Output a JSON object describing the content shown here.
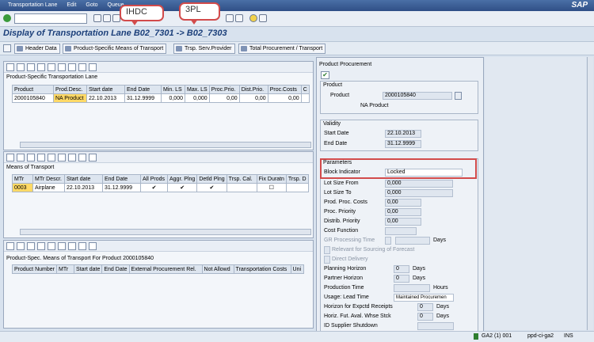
{
  "menu": [
    "Transportation Lane",
    "Edit",
    "Goto",
    "Queue",
    "",
    "",
    "tem"
  ],
  "sap_logo": "SAP",
  "title": "Display of Transportation Lane B02_7301 -> B02_7303",
  "callouts": {
    "a": "IHDC",
    "b": "3PL"
  },
  "app_buttons": [
    "Header Data",
    "Product-Specific Means of Transport",
    "Trsp. Serv.Provider",
    "Total Procurement / Transport"
  ],
  "pane1": {
    "title": "Product-Specific Transportation Lane",
    "headers": [
      "Product",
      "Prod.Desc.",
      "Start date",
      "End Date",
      "Min. LS",
      "Max. LS",
      "Proc.Prio.",
      "Dist.Prio.",
      "Proc.Costs",
      "C"
    ],
    "row": [
      "2000105840",
      "NA Product",
      "22.10.2013",
      "31.12.9999",
      "0,000",
      "0,000",
      "0,00",
      "0,00",
      "0,00",
      ""
    ]
  },
  "pane2": {
    "title": "Means of Transport",
    "headers": [
      "MTr",
      "MTr Descr.",
      "Start date",
      "End Date",
      "All Prods",
      "Aggr. Plng",
      "Detld Plng",
      "Trsp. Cal.",
      "Fix Duratn",
      "Trsp. D"
    ],
    "row": [
      "0003",
      "Airplane",
      "22.10.2013",
      "31.12.9999"
    ]
  },
  "pane3": {
    "title": "Product-Spec. Means of Transport For Product 2000105840",
    "headers": [
      "Product Number",
      "MTr",
      "Start date",
      "End Date",
      "External Procurement Rel.",
      "Not Allowd",
      "Transportation Costs",
      "Uni"
    ]
  },
  "right": {
    "header": "Product Procurement",
    "product": {
      "group": "Product",
      "label": "Product",
      "value": "2000105840",
      "desc": "NA Product"
    },
    "validity": {
      "group": "Validity",
      "start_lbl": "Start Date",
      "start": "22.10.2013",
      "end_lbl": "End Date",
      "end": "31.12.9999"
    },
    "params": {
      "group": "Parameters",
      "block_lbl": "Block Indicator",
      "block": "Locked",
      "lsfrom_lbl": "Lot Size From",
      "lsfrom": "0,000",
      "lsto_lbl": "Lot Size To",
      "lsto": "0,000",
      "ppc_lbl": "Prod. Proc. Costs",
      "ppc": "0,00",
      "pprio_lbl": "Proc. Priority",
      "pprio": "0,00",
      "dprio_lbl": "Distrib. Priority",
      "dprio": "0,00",
      "cost_lbl": "Cost Function",
      "gr_lbl": "GR Processing Time",
      "days": "Days",
      "relev_lbl": "Relevant for Sourcing of Forecast",
      "direct_lbl": "Direct Delivery",
      "plan_lbl": "Planning Horizon",
      "plan": "0",
      "partner_lbl": "Partner Horizon",
      "partner": "0",
      "prod_lbl": "Production Time",
      "hours": "Hours",
      "usage_lbl": "Usage: Lead Time",
      "usage": "Maintained Procuremen",
      "exp_lbl": "Horizon for Expctd Receipts",
      "exp": "0",
      "fut_lbl": "Horiz. Fut. Aval. Whse Stck",
      "fut": "0",
      "id_lbl": "ID Supplier Shutdown"
    }
  },
  "status": {
    "system": "GA2 (1) 001",
    "server": "ppd-ci-ga2",
    "mode": "INS"
  }
}
